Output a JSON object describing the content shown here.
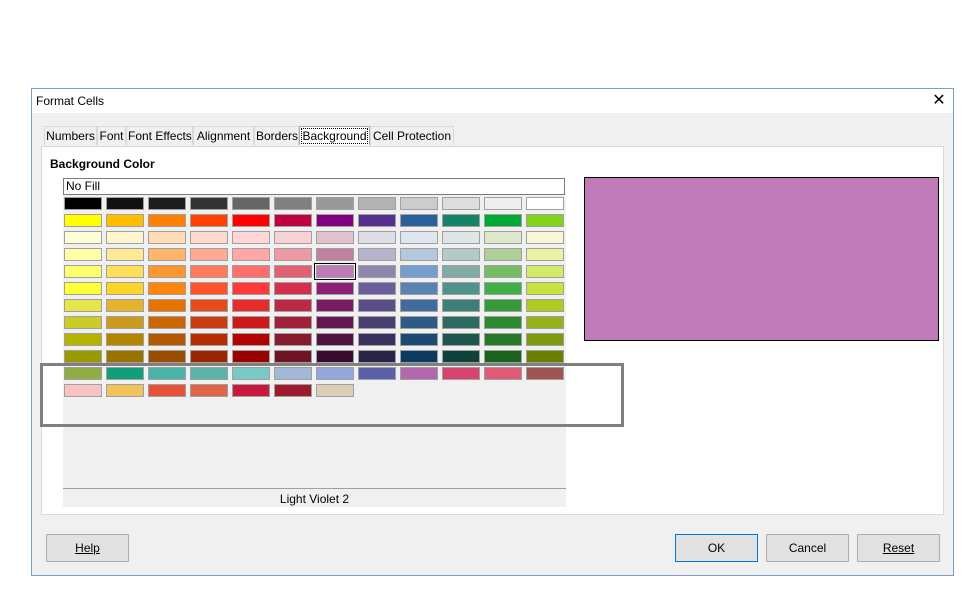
{
  "dialog": {
    "title": "Format Cells"
  },
  "tabs": [
    {
      "label": "Numbers"
    },
    {
      "label": "Font"
    },
    {
      "label": "Font Effects"
    },
    {
      "label": "Alignment"
    },
    {
      "label": "Borders"
    },
    {
      "label": "Background",
      "active": true
    },
    {
      "label": "Cell Protection"
    }
  ],
  "background": {
    "section_label": "Background Color",
    "no_fill_label": "No Fill",
    "selected_color_name": "Light Violet 2",
    "preview_color": "#bf7ab8"
  },
  "palette": [
    [
      "#000000",
      "#111111",
      "#1c1c1c",
      "#333333",
      "#666666",
      "#808080",
      "#999999",
      "#b2b2b2",
      "#cccccc",
      "#dddddd",
      "#eeeeee",
      "#ffffff"
    ],
    [
      "#ffff00",
      "#ffbf00",
      "#ff8000",
      "#ff4000",
      "#ff0000",
      "#bf0041",
      "#800080",
      "#55308d",
      "#2a6099",
      "#158466",
      "#00a933",
      "#81d41a"
    ],
    [
      "#ffffd7",
      "#fff5ce",
      "#ffdbb6",
      "#ffd8ce",
      "#ffd7d7",
      "#f7d1d5",
      "#e0c2cd",
      "#dedce6",
      "#dee6ef",
      "#dee7e5",
      "#dde8cb",
      "#f6f9d4"
    ],
    [
      "#ffffa6",
      "#ffe994",
      "#ffb66c",
      "#ffaa95",
      "#ffa6a6",
      "#ec9ba4",
      "#bf819e",
      "#b7b3ca",
      "#b4c7dc",
      "#b3cac7",
      "#afd095",
      "#e8f2a1"
    ],
    [
      "#ffff6d",
      "#ffde59",
      "#ff972f",
      "#ff7b59",
      "#ff6d6d",
      "#e16173",
      "#bf7ab8",
      "#8e86ae",
      "#729fcf",
      "#81aca6",
      "#77bc65",
      "#d4ea6b"
    ],
    [
      "#ffff38",
      "#ffd428",
      "#ff860d",
      "#ff5429",
      "#ff3838",
      "#d62e4e",
      "#8d1d75",
      "#6b5e9b",
      "#5983b0",
      "#50938a",
      "#3faf46",
      "#c9e33e"
    ],
    [
      "#e6e64c",
      "#e6b32c",
      "#e67300",
      "#e64c1a",
      "#e62b2b",
      "#ba2946",
      "#7a1c62",
      "#5b4e87",
      "#426a9a",
      "#3d7f74",
      "#379939",
      "#aecb21"
    ],
    [
      "#cccc26",
      "#cc9a1e",
      "#cc6600",
      "#cc3c10",
      "#cc1a1a",
      "#a12138",
      "#63184f",
      "#4a3f73",
      "#2e5a86",
      "#2d6b61",
      "#2e8a31",
      "#96b21a"
    ],
    [
      "#b3b300",
      "#b38600",
      "#b35900",
      "#b32e00",
      "#b30000",
      "#871c2f",
      "#4e1340",
      "#3a305e",
      "#1d4a73",
      "#1e564e",
      "#267728",
      "#7f9a0d"
    ],
    [
      "#999900",
      "#997300",
      "#994d00",
      "#992600",
      "#990000",
      "#6e1424",
      "#380c2f",
      "#2b2449",
      "#0d3a5f",
      "#0e423b",
      "#1a631d",
      "#687f00"
    ],
    [
      "#8fad42",
      "#119e78",
      "#4ab3a8",
      "#5cb3a9",
      "#78c9c6",
      "#a2b8d6",
      "#93a8d8",
      "#5b5fa8",
      "#b368ad",
      "#d6436e",
      "#e05a74",
      "#9e5450"
    ],
    [
      "#f9c3c6",
      "#f2c35a",
      "#e65338",
      "#e06547",
      "#c8183c",
      "#9b1b2c",
      "#dccdb5"
    ]
  ],
  "selected_swatch": {
    "row": 4,
    "col": 6
  },
  "buttons": {
    "help": "Help",
    "ok": "OK",
    "cancel": "Cancel",
    "reset": "Reset"
  }
}
